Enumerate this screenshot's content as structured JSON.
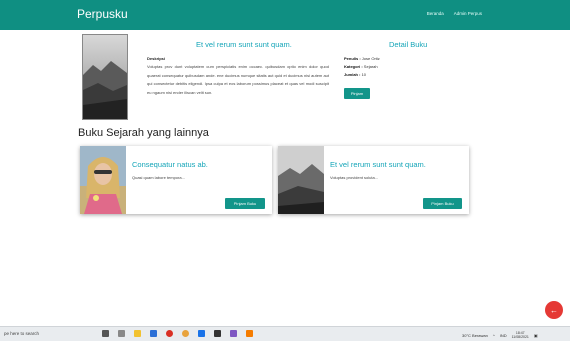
{
  "navbar": {
    "brand": "Perpusku",
    "links": [
      "Beranda",
      "Admin Perpus"
    ],
    "bg": "#0f8f82"
  },
  "detail": {
    "title": "Et vel rerum sunt sunt quam.",
    "desc_heading": "Deskripsi",
    "desc": "Voluptas prov dunt voluptatem cum perspiciatis enim occaec. quibusdam optio enim dolor quod quaerat consequatur quibusdam ande. ene ducimus numque sitatis aut quid et ducimus nisi autem aut qui consectetur debitis eligendi. Ipsa culpa et eos laborum possimus placeat et quas vel modi suscipit eu ngaum nisi ender iliscan velit sun.",
    "side_title": "Detail Buku",
    "penulis_label": "Penulis :",
    "penulis": "Jose Ortiz",
    "kategori_label": "Kategori :",
    "kategori": "Sejarah",
    "jumlah_label": "Jumlah :",
    "jumlah": "10",
    "button": "Pinjam"
  },
  "section_title": "Buku Sejarah yang lainnya",
  "cards": [
    {
      "title": "Consequatur natus ab.",
      "text": "Quasi quam labore tempora...",
      "button": "Pinjam Buku"
    },
    {
      "title": "Et vel rerum sunt sunt quam.",
      "text": "Voluptas provident soluta...",
      "button": "Pinjam Buku"
    }
  ],
  "fab_icon": "arrow-left-icon",
  "taskbar": {
    "search": "pe here to search",
    "weather": "30°C Berawan",
    "lang": "IND",
    "time": "18:47",
    "date": "11/08/2021",
    "icons": [
      "windows-icon",
      "task-view-icon",
      "explorer-icon",
      "store-icon",
      "mail-icon",
      "chrome-icon",
      "vscode-icon",
      "terminal-icon",
      "vs-icon",
      "xampp-icon"
    ]
  }
}
